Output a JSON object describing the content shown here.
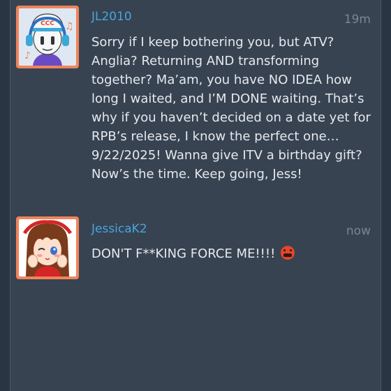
{
  "messages": [
    {
      "author": "JL2010",
      "time": "19m",
      "text": "Sorry if I keep bothering you, but ATV? Anglia? Returning AND transforming together? Ma’am, you have NO IDEA how long I waited, and I’M DONE waiting. That’s why if you haven’t decided on a date yet for RPB’s release, I know the perfect one… 9/22/2025! Wanna give ITV a birthday gift? Now’s the time. Keep going, Jess!",
      "avatar_label": "CCC"
    },
    {
      "author": "JessicaK2",
      "time": "now",
      "text": "DON'T F**KING FORCE ME!!!!",
      "emoji": "angry-cursing-face"
    }
  ],
  "colors": {
    "background": "#2a3544",
    "panel": "#374351",
    "author": "#4aa3e0",
    "avatar_border": "#f0845b",
    "text": "#e6e9ee",
    "timestamp": "#7b8694"
  }
}
